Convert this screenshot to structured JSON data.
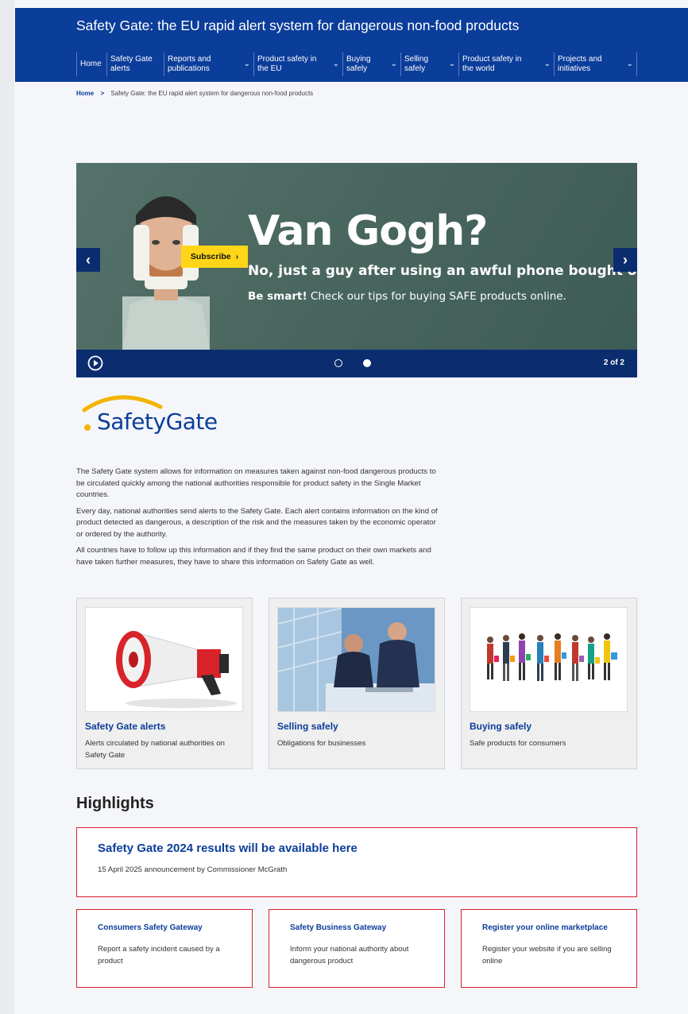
{
  "header": {
    "title": "Safety Gate: the EU rapid alert system for dangerous non-food products",
    "nav": [
      {
        "label": "Home",
        "dropdown": false
      },
      {
        "label": "Safety Gate alerts",
        "dropdown": false
      },
      {
        "label": "Reports and publications",
        "dropdown": true
      },
      {
        "label": "Product safety in the EU",
        "dropdown": true
      },
      {
        "label": "Buying safely",
        "dropdown": true
      },
      {
        "label": "Selling safely",
        "dropdown": true
      },
      {
        "label": "Product safety in the world",
        "dropdown": true
      },
      {
        "label": "Projects and initiatives",
        "dropdown": true
      }
    ]
  },
  "breadcrumb": {
    "home": "Home",
    "current": "Safety Gate: the EU rapid alert system for dangerous non-food products"
  },
  "carousel": {
    "headline": "Van Gogh?",
    "subline": "No, just a guy after using an awful phone bought online.",
    "tips_bold": "Be smart!",
    "tips_rest": " Check our tips for buying SAFE products online.",
    "subscribe_label": "Subscribe",
    "counter": "2 of 2",
    "active_slide": 2,
    "total_slides": 2
  },
  "logo": {
    "text": "SafetyGate"
  },
  "intro": {
    "paragraphs": [
      "The Safety Gate system allows for information on measures taken against non-food dangerous products to be circulated quickly among the national authorities responsible for product safety in the Single Market countries.",
      "Every day, national authorities send alerts to the Safety Gate. Each alert contains information on the kind of product detected as dangerous, a description of the risk and the measures taken by the economic operator or ordered by the authority.",
      "All countries have to follow up this information and if they find the same product on their own markets and have taken further measures, they have to share this information on Safety Gate as well."
    ]
  },
  "cards": [
    {
      "title": "Safety Gate alerts",
      "description": "Alerts circulated by national authorities on Safety Gate",
      "icon": "megaphone-image"
    },
    {
      "title": "Selling safely",
      "description": "Obligations for businesses",
      "icon": "business-people-image"
    },
    {
      "title": "Buying safely",
      "description": "Safe products for consumers",
      "icon": "shoppers-image"
    }
  ],
  "highlights": {
    "title": "Highlights",
    "main": {
      "title": "Safety Gate 2024 results will be available here",
      "subtitle": "15 April 2025 announcement by Commissioner McGrath"
    },
    "cards": [
      {
        "title": "Consumers Safety Gateway",
        "description": "Report a safety incident caused by a product"
      },
      {
        "title": "Safety Business Gateway",
        "description": "Inform your national authority about dangerous product"
      },
      {
        "title": "Register your online marketplace",
        "description": "Register your website if you are selling online"
      }
    ]
  },
  "colors": {
    "brand_blue": "#0b3d9a",
    "subscribe_yellow": "#ffd617",
    "highlight_red": "#d81e2c"
  }
}
